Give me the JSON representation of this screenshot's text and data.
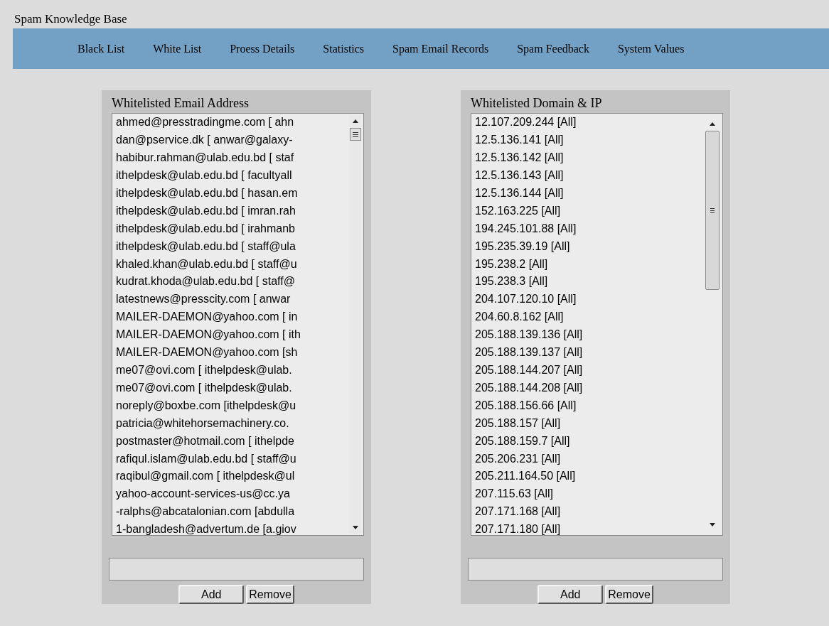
{
  "title": "Spam Knowledge Base",
  "nav": [
    "Black List",
    "White List",
    "Proess Details",
    "Statistics",
    "Spam Email Records",
    "Spam Feedback",
    "System Values"
  ],
  "panels": [
    {
      "heading": "Whitelisted Email Address",
      "kind": "narrow",
      "items": [
        "ahmed@presstradingme.com [ ahn",
        "dan@pservice.dk [ anwar@galaxy-",
        "habibur.rahman@ulab.edu.bd [ staf",
        "ithelpdesk@ulab.edu.bd [ facultyall",
        "ithelpdesk@ulab.edu.bd [ hasan.em",
        "ithelpdesk@ulab.edu.bd [ imran.rah",
        "ithelpdesk@ulab.edu.bd [ irahmanb",
        "ithelpdesk@ulab.edu.bd [ staff@ula",
        "khaled.khan@ulab.edu.bd [ staff@u",
        "kudrat.khoda@ulab.edu.bd [ staff@",
        "latestnews@presscity.com [ anwar",
        "MAILER-DAEMON@yahoo.com [ in",
        "MAILER-DAEMON@yahoo.com [ ith",
        "MAILER-DAEMON@yahoo.com [sh",
        "me07@ovi.com [ ithelpdesk@ulab.",
        "me07@ovi.com [ ithelpdesk@ulab.",
        "noreply@boxbe.com [ithelpdesk@u",
        "patricia@whitehorsemachinery.co.",
        "postmaster@hotmail.com [ ithelpde",
        "rafiqul.islam@ulab.edu.bd [ staff@u",
        "raqibul@gmail.com [ ithelpdesk@ul",
        "yahoo-account-services-us@cc.ya",
        "-ralphs@abcatalonian.com [abdulla",
        "1-bangladesh@advertum.de [a.giov"
      ],
      "buttons": [
        "Add",
        "Remove"
      ]
    },
    {
      "heading": "Whitelisted Domain & IP",
      "kind": "wide",
      "items": [
        "12.107.209.244 [All]",
        "12.5.136.141 [All]",
        "12.5.136.142 [All]",
        "12.5.136.143 [All]",
        "12.5.136.144 [All]",
        "152.163.225 [All]",
        "194.245.101.88 [All]",
        "195.235.39.19 [All]",
        "195.238.2 [All]",
        "195.238.3 [All]",
        "204.107.120.10 [All]",
        "204.60.8.162 [All]",
        "205.188.139.136 [All]",
        "205.188.139.137 [All]",
        "205.188.144.207 [All]",
        "205.188.144.208 [All]",
        "205.188.156.66 [All]",
        "205.188.157 [All]",
        "205.188.159.7 [All]",
        "205.206.231 [All]",
        "205.211.164.50 [All]",
        "207.115.63 [All]",
        "207.171.168 [All]",
        "207.171.180 [All]"
      ],
      "buttons": [
        "Add",
        "Remove"
      ]
    }
  ]
}
